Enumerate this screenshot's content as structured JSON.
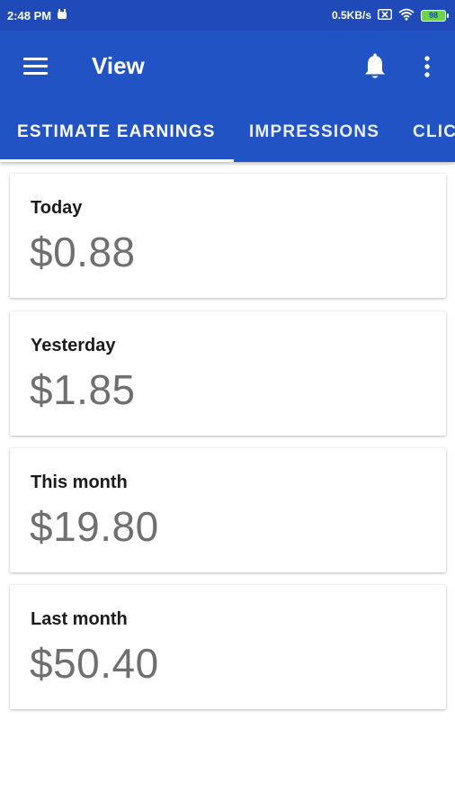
{
  "status_bar": {
    "time": "2:48 PM",
    "network_speed": "0.5KB/s",
    "battery_level": "98",
    "icons": [
      "android-icon",
      "sim-x-icon",
      "wifi-icon",
      "battery-icon"
    ]
  },
  "toolbar": {
    "title": "View",
    "menu_icon": "hamburger-menu-icon",
    "notification_icon": "bell-icon",
    "overflow_icon": "more-vert-icon",
    "background_color": "#2153c4"
  },
  "tabs": [
    {
      "label": "ESTIMATE EARNINGS",
      "selected": true
    },
    {
      "label": "IMPRESSIONS",
      "selected": false
    },
    {
      "label": "CLICKS",
      "selected": false
    }
  ],
  "cards": [
    {
      "label": "Today",
      "value": "$0.88"
    },
    {
      "label": "Yesterday",
      "value": "$1.85"
    },
    {
      "label": "This month",
      "value": "$19.80"
    },
    {
      "label": "Last month",
      "value": "$50.40"
    }
  ]
}
